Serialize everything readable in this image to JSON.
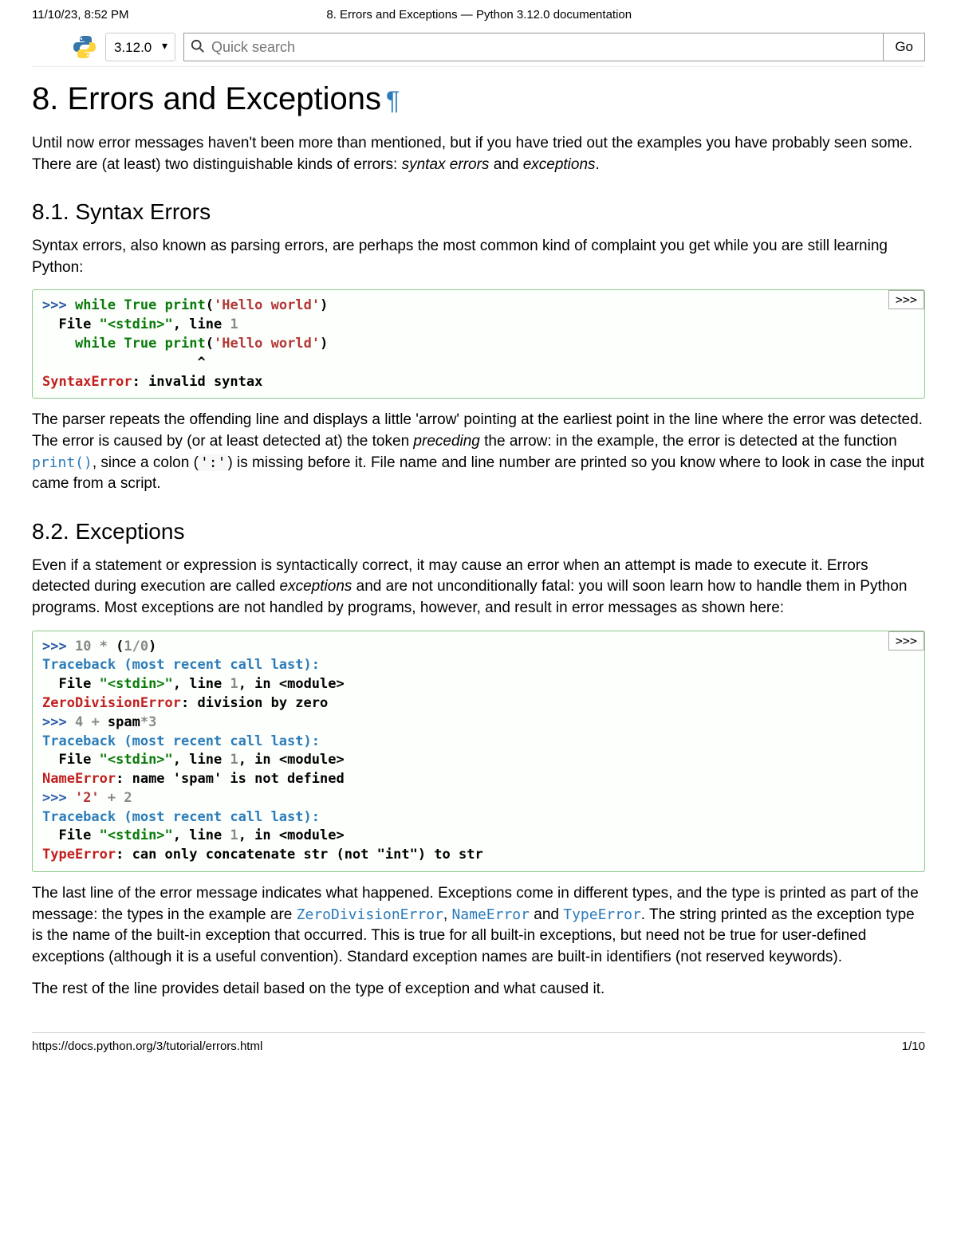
{
  "print_header": {
    "datetime": "11/10/23, 8:52 PM",
    "title": "8. Errors and Exceptions — Python 3.12.0 documentation"
  },
  "toolbar": {
    "version": "3.12.0",
    "search_placeholder": "Quick search",
    "go_label": "Go"
  },
  "h1": "8. Errors and Exceptions",
  "intro": {
    "t1": "Until now error messages haven't been more than mentioned, but if you have tried out the examples you have probably seen some. There are (at least) two distinguishable kinds of errors: ",
    "em1": "syntax errors",
    "t2": " and ",
    "em2": "exceptions",
    "t3": "."
  },
  "syntax": {
    "h2": "8.1. Syntax Errors",
    "p1": "Syntax errors, also known as parsing errors, are perhaps the most common kind of complaint you get while you are still learning Python:",
    "copy": ">>>",
    "code": {
      "prompt1": ">>> ",
      "kw_while1": "while",
      "kw_true1": " True ",
      "print1": "print",
      "paren1_open": "(",
      "str1": "'Hello world'",
      "paren1_close": ")",
      "file_line": "  File ",
      "stdin1": "\"<stdin>\"",
      "line_info1": ", line ",
      "linenum1": "1",
      "indent": "    ",
      "kw_while2": "while",
      "kw_true2": " True ",
      "print2": "print",
      "paren2_open": "(",
      "str2": "'Hello world'",
      "paren2_close": ")",
      "caret": "                   ^",
      "errname": "SyntaxError",
      "errmsg": ": invalid syntax"
    },
    "para2": {
      "t1": "The parser repeats the offending line and displays a little 'arrow' pointing at the earliest point in the line where the error was detected. The error is caused by (or at least detected at) the token ",
      "em1": "preceding",
      "t2": " the arrow: in the example, the error is detected at the function ",
      "code1": "print()",
      "t3": ", since a colon (",
      "lit1": "':'",
      "t4": ") is missing before it. File name and line number are printed so you know where to look in case the input came from a script."
    }
  },
  "exceptions": {
    "h2": "8.2. Exceptions",
    "p1": {
      "t1": "Even if a statement or expression is syntactically correct, it may cause an error when an attempt is made to execute it. Errors detected during execution are called ",
      "em1": "exceptions",
      "t2": " and are not unconditionally fatal: you will soon learn how to handle them in Python programs. Most exceptions are not handled by programs, however, and result in error messages as shown here:"
    },
    "copy": ">>>",
    "code": {
      "p1": ">>> ",
      "n1a": "10",
      "op1a": " * ",
      "paren_o": "(",
      "n1b": "1",
      "op1b": "/",
      "n1c": "0",
      "paren_c": ")",
      "tb1": "Traceback (most recent call last):",
      "file": "  File ",
      "stdin": "\"<stdin>\"",
      "lineinfo_a": ", line ",
      "linenum": "1",
      "lineinfo_b": ", in <module>",
      "err1": "ZeroDivisionError",
      "msg1": ": division by zero",
      "p2": ">>> ",
      "n2a": "4",
      "op2a": " + ",
      "spam": "spam",
      "op2b": "*",
      "n2b": "3",
      "tb2": "Traceback (most recent call last):",
      "err2": "NameError",
      "msg2": ": name 'spam' is not defined",
      "p3": ">>> ",
      "s3": "'2'",
      "op3a": " + ",
      "n3": "2",
      "tb3": "Traceback (most recent call last):",
      "err3": "TypeError",
      "msg3": ": can only concatenate str (not \"int\") to str"
    },
    "para2": {
      "t1": "The last line of the error message indicates what happened. Exceptions come in different types, and the type is printed as part of the message: the types in the example are ",
      "c1": "ZeroDivisionError",
      "t2": ", ",
      "c2": "NameError",
      "t3": " and ",
      "c3": "TypeError",
      "t4": ". The string printed as the exception type is the name of the built-in exception that occurred. This is true for all built-in exceptions, but need not be true for user-defined exceptions (although it is a useful convention). Standard exception names are built-in identifiers (not reserved keywords)."
    },
    "p3": "The rest of the line provides detail based on the type of exception and what caused it."
  },
  "print_footer": {
    "url": "https://docs.python.org/3/tutorial/errors.html",
    "page": "1/10"
  }
}
